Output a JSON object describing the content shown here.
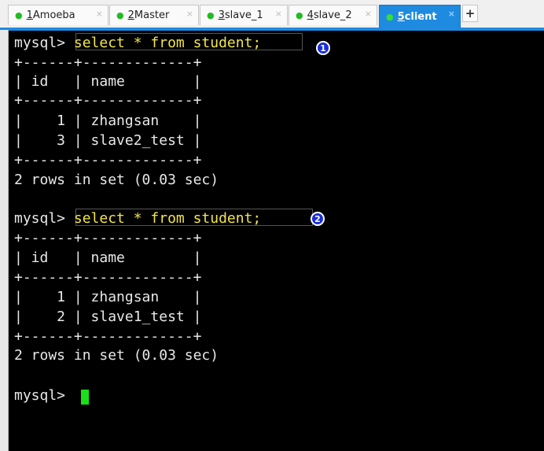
{
  "tabs": [
    {
      "num": "1",
      "label": " Amoeba",
      "active": false
    },
    {
      "num": "2",
      "label": " Master",
      "active": false
    },
    {
      "num": "3",
      "label": " slave_1",
      "active": false
    },
    {
      "num": "4",
      "label": " slave_2",
      "active": false
    },
    {
      "num": "5",
      "label": " client",
      "active": true
    }
  ],
  "tab_icons": {
    "status": "green-dot-icon",
    "close": "close-icon",
    "add": "plus-icon"
  },
  "close_glyph": "×",
  "add_tab_label": "+",
  "colors": {
    "active_tab": "#1e8be0",
    "status_dot": "#22bb22",
    "command_text": "#f2e64b",
    "cursor": "#19e019",
    "marker": "#1a2ddc"
  },
  "query1": {
    "prompt": "mysql> ",
    "command": "select * from student;",
    "marker": "1",
    "border_top": "+------+-------------+",
    "header": "| id   | name        |",
    "border_mid": "+------+-------------+",
    "rows": [
      "|    1 | zhangsan    |",
      "|    3 | slave2_test |"
    ],
    "border_bottom": "+------+-------------+",
    "summary": "2 rows in set (0.03 sec)"
  },
  "query2": {
    "prompt": "mysql> ",
    "command": "select * from student;",
    "marker": "2",
    "border_top": "+------+-------------+",
    "header": "| id   | name        |",
    "border_mid": "+------+-------------+",
    "rows": [
      "|    1 | zhangsan    |",
      "|    2 | slave1_test |"
    ],
    "border_bottom": "+------+-------------+",
    "summary": "2 rows in set (0.03 sec)"
  },
  "final_prompt": "mysql> "
}
